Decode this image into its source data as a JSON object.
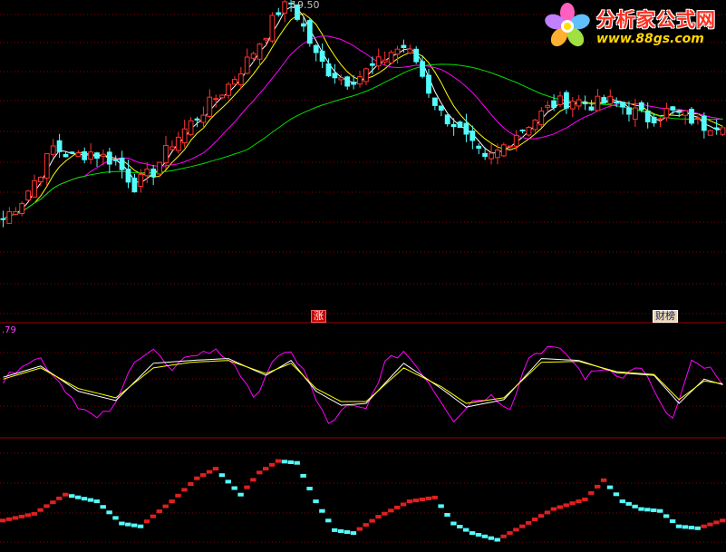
{
  "chart": {
    "high_price_label": "19.50",
    "pane2_value_label": ".79",
    "signal_tags": [
      "涨",
      "财榜"
    ],
    "logo_title": "分析家公式网",
    "logo_url": "www.88gs.com"
  },
  "colors": {
    "background": "#000000",
    "up_candle": "#ff3232",
    "down_candle": "#54fcfc",
    "ma_short": "#ffffff",
    "ma_mid": "#ffff00",
    "ma_long": "#ff00ff",
    "ma_longest": "#00e000",
    "grid": "#8b0000",
    "pane_divider": "#a00000",
    "osc_fast": "#ff00ff",
    "osc_slow1": "#ffffff",
    "osc_slow2": "#ffff00",
    "step_up": "#e02020",
    "step_down": "#54fcfc"
  },
  "chart_data": [
    {
      "type": "candlestick",
      "title": "",
      "annotations": [
        "19.50",
        "涨",
        "财榜"
      ],
      "highest_price": 19.5,
      "close_path": [
        [
          0,
          0.1
        ],
        [
          3,
          0.18
        ],
        [
          6,
          0.3
        ],
        [
          8,
          0.4
        ],
        [
          11,
          0.36
        ],
        [
          14,
          0.38
        ],
        [
          18,
          0.34
        ],
        [
          21,
          0.24
        ],
        [
          24,
          0.3
        ],
        [
          27,
          0.42
        ],
        [
          30,
          0.5
        ],
        [
          33,
          0.58
        ],
        [
          36,
          0.66
        ],
        [
          39,
          0.76
        ],
        [
          42,
          0.88
        ],
        [
          44,
          0.97
        ],
        [
          46,
          1.0
        ],
        [
          48,
          0.9
        ],
        [
          50,
          0.78
        ],
        [
          52,
          0.72
        ],
        [
          55,
          0.68
        ],
        [
          57,
          0.7
        ],
        [
          60,
          0.75
        ],
        [
          62,
          0.8
        ],
        [
          64,
          0.82
        ],
        [
          66,
          0.76
        ],
        [
          68,
          0.64
        ],
        [
          70,
          0.54
        ],
        [
          72,
          0.5
        ],
        [
          75,
          0.4
        ],
        [
          77,
          0.34
        ],
        [
          79,
          0.38
        ],
        [
          82,
          0.46
        ],
        [
          85,
          0.52
        ],
        [
          88,
          0.58
        ],
        [
          91,
          0.6
        ],
        [
          94,
          0.58
        ],
        [
          97,
          0.59
        ],
        [
          100,
          0.56
        ],
        [
          103,
          0.52
        ],
        [
          106,
          0.55
        ],
        [
          109,
          0.53
        ],
        [
          112,
          0.49
        ],
        [
          115,
          0.51
        ]
      ],
      "moving_averages": [
        "short",
        "mid",
        "long",
        "longest"
      ]
    },
    {
      "type": "line",
      "title": "",
      "series": [
        {
          "values_path": [
            [
              0,
              0.55
            ],
            [
              3,
              0.75
            ],
            [
              6,
              0.8
            ],
            [
              9,
              0.55
            ],
            [
              12,
              0.3
            ],
            [
              15,
              0.15
            ],
            [
              18,
              0.3
            ],
            [
              21,
              0.8
            ],
            [
              24,
              0.9
            ],
            [
              27,
              0.65
            ],
            [
              30,
              0.85
            ],
            [
              34,
              0.88
            ],
            [
              37,
              0.75
            ],
            [
              40,
              0.35
            ],
            [
              43,
              0.78
            ],
            [
              46,
              0.85
            ],
            [
              48,
              0.7
            ],
            [
              50,
              0.35
            ],
            [
              52,
              0.1
            ],
            [
              55,
              0.28
            ],
            [
              58,
              0.25
            ],
            [
              61,
              0.75
            ],
            [
              64,
              0.88
            ],
            [
              67,
              0.65
            ],
            [
              70,
              0.35
            ],
            [
              72,
              0.15
            ],
            [
              75,
              0.35
            ],
            [
              78,
              0.4
            ],
            [
              81,
              0.28
            ],
            [
              84,
              0.82
            ],
            [
              87,
              0.92
            ],
            [
              90,
              0.85
            ],
            [
              93,
              0.6
            ],
            [
              96,
              0.7
            ],
            [
              99,
              0.62
            ],
            [
              102,
              0.72
            ],
            [
              105,
              0.3
            ],
            [
              107,
              0.15
            ],
            [
              110,
              0.75
            ],
            [
              113,
              0.68
            ],
            [
              115,
              0.5
            ]
          ]
        },
        {
          "values_path": [
            [
              0,
              0.6
            ],
            [
              6,
              0.72
            ],
            [
              12,
              0.45
            ],
            [
              18,
              0.35
            ],
            [
              24,
              0.75
            ],
            [
              30,
              0.78
            ],
            [
              36,
              0.8
            ],
            [
              42,
              0.62
            ],
            [
              46,
              0.78
            ],
            [
              50,
              0.45
            ],
            [
              54,
              0.3
            ],
            [
              58,
              0.32
            ],
            [
              64,
              0.75
            ],
            [
              70,
              0.48
            ],
            [
              74,
              0.28
            ],
            [
              80,
              0.36
            ],
            [
              86,
              0.8
            ],
            [
              92,
              0.78
            ],
            [
              98,
              0.65
            ],
            [
              104,
              0.62
            ],
            [
              108,
              0.32
            ],
            [
              112,
              0.58
            ],
            [
              115,
              0.52
            ]
          ]
        },
        {
          "values_path": [
            [
              0,
              0.58
            ],
            [
              6,
              0.7
            ],
            [
              12,
              0.48
            ],
            [
              18,
              0.38
            ],
            [
              24,
              0.7
            ],
            [
              30,
              0.76
            ],
            [
              36,
              0.78
            ],
            [
              42,
              0.64
            ],
            [
              46,
              0.75
            ],
            [
              50,
              0.48
            ],
            [
              54,
              0.34
            ],
            [
              58,
              0.34
            ],
            [
              64,
              0.7
            ],
            [
              70,
              0.5
            ],
            [
              74,
              0.32
            ],
            [
              80,
              0.38
            ],
            [
              86,
              0.76
            ],
            [
              92,
              0.77
            ],
            [
              98,
              0.66
            ],
            [
              104,
              0.63
            ],
            [
              108,
              0.36
            ],
            [
              112,
              0.56
            ],
            [
              115,
              0.53
            ]
          ]
        }
      ]
    },
    {
      "type": "step",
      "title": "",
      "values_path": [
        [
          0,
          0.28
        ],
        [
          5,
          0.35
        ],
        [
          10,
          0.55
        ],
        [
          15,
          0.48
        ],
        [
          19,
          0.25
        ],
        [
          22,
          0.22
        ],
        [
          27,
          0.48
        ],
        [
          31,
          0.72
        ],
        [
          34,
          0.82
        ],
        [
          38,
          0.55
        ],
        [
          41,
          0.78
        ],
        [
          44,
          0.9
        ],
        [
          47,
          0.88
        ],
        [
          50,
          0.48
        ],
        [
          53,
          0.18
        ],
        [
          56,
          0.15
        ],
        [
          60,
          0.32
        ],
        [
          65,
          0.48
        ],
        [
          69,
          0.52
        ],
        [
          72,
          0.25
        ],
        [
          75,
          0.15
        ],
        [
          79,
          0.08
        ],
        [
          83,
          0.22
        ],
        [
          88,
          0.4
        ],
        [
          93,
          0.5
        ],
        [
          96,
          0.7
        ],
        [
          99,
          0.48
        ],
        [
          102,
          0.4
        ],
        [
          105,
          0.38
        ],
        [
          108,
          0.22
        ],
        [
          111,
          0.2
        ],
        [
          115,
          0.28
        ]
      ]
    }
  ]
}
